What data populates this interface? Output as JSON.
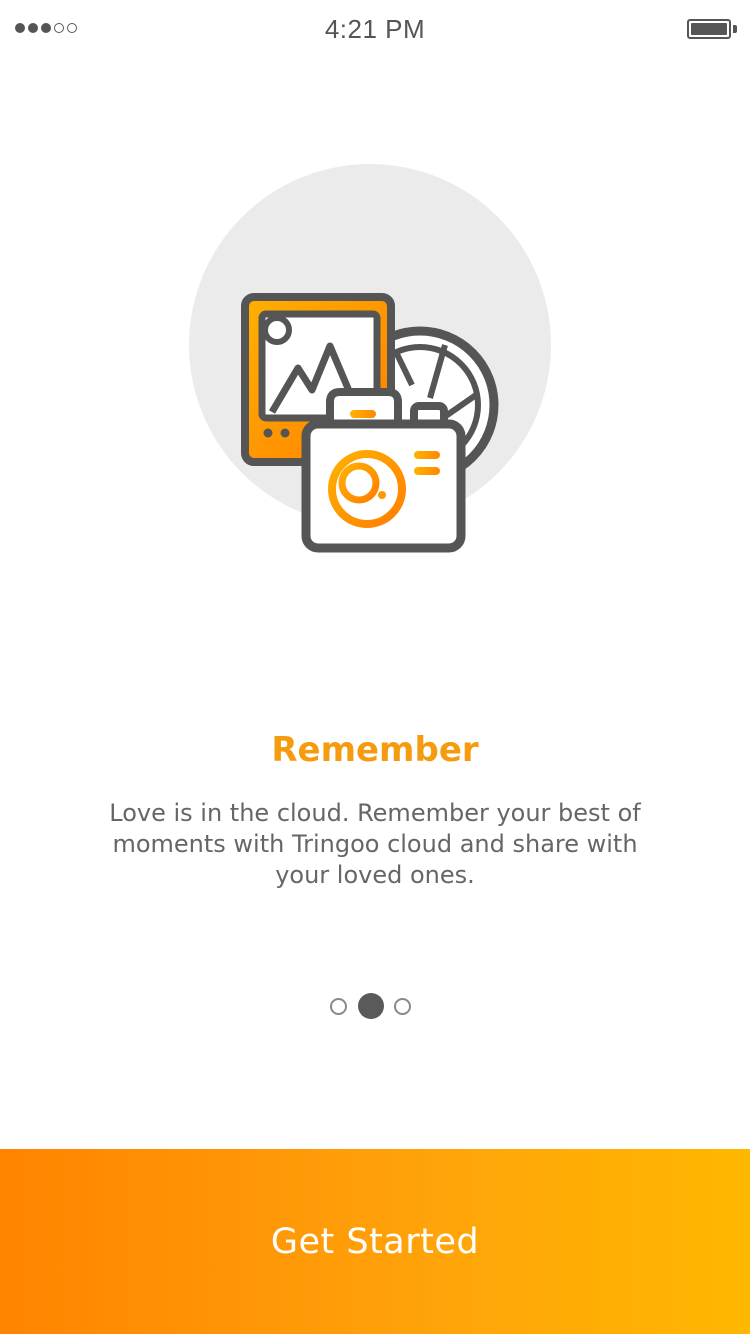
{
  "status_bar": {
    "time": "4:21 PM",
    "signal_bars_filled": 3,
    "signal_bars_total": 5,
    "battery_level": 1.0
  },
  "illustration": {
    "icon": "photos-camera-icon",
    "accent_gradient": [
      "#ffb000",
      "#ff8000"
    ],
    "stroke_color": "#555555",
    "backdrop_color": "#ebebeb"
  },
  "onboarding": {
    "title": "Remember",
    "description": "Love is in the cloud. Remember your best of moments with Tringoo cloud and share with your loved ones.",
    "title_color": "#f59b0f",
    "text_color": "#666666"
  },
  "pager": {
    "current_page": 2,
    "total_pages": 3
  },
  "cta": {
    "label": "Get Started",
    "gradient": [
      "#ff8400",
      "#ffb700"
    ]
  }
}
